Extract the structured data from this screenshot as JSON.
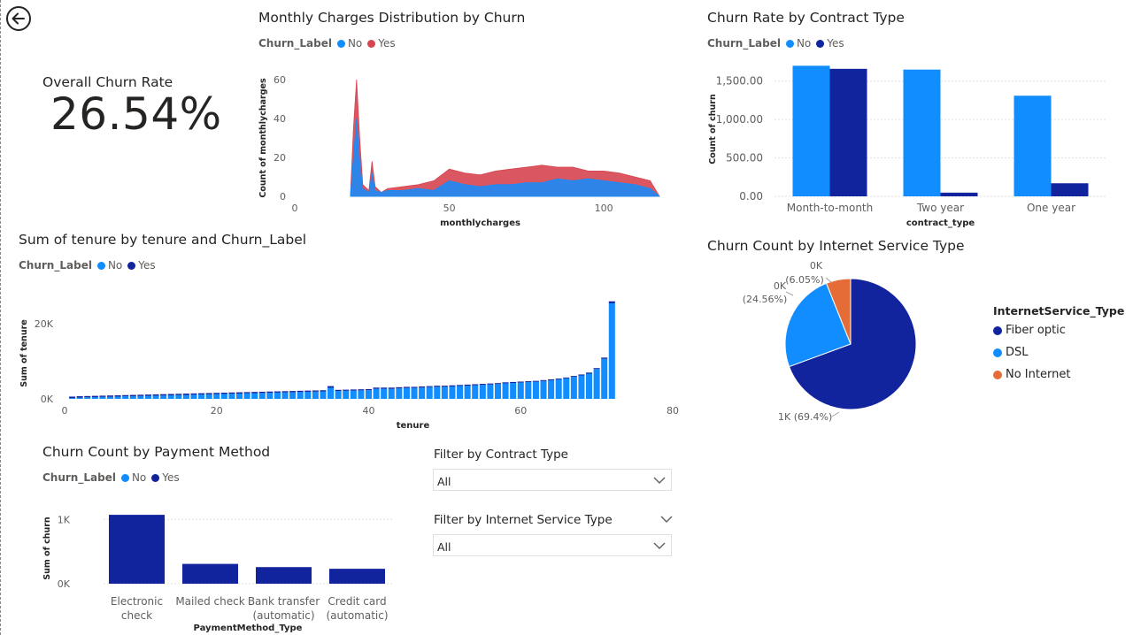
{
  "colors": {
    "no": "#118dff",
    "yes": "#12239e",
    "hist_yes": "#d64550",
    "no_internet": "#e66c37",
    "axis": "#605e5c",
    "grid": "#e1dfdd"
  },
  "kpi": {
    "label": "Overall Churn Rate",
    "value": "26.54%"
  },
  "monthly": {
    "title": "Monthly Charges Distribution by Churn",
    "legend_title": "Churn_Label",
    "legend": [
      "No",
      "Yes"
    ],
    "chart_data": {
      "type": "area",
      "title": "Monthly Charges Distribution by Churn",
      "xlabel": "monthlycharges",
      "ylabel": "Count of monthlycharges",
      "xlim": [
        0,
        120
      ],
      "ylim": [
        0,
        60
      ],
      "xticks": [
        "0",
        "50",
        "100"
      ],
      "yticks": [
        "0",
        "20",
        "40",
        "60"
      ],
      "series": [
        {
          "name": "No",
          "x": [
            18,
            19,
            20,
            21,
            22,
            24,
            25,
            26,
            28,
            30,
            35,
            40,
            45,
            50,
            55,
            60,
            65,
            70,
            75,
            80,
            85,
            90,
            95,
            100,
            105,
            110,
            115,
            118
          ],
          "values": [
            0,
            20,
            40,
            18,
            4,
            2,
            12,
            3,
            2,
            3,
            3,
            4,
            3,
            8,
            6,
            5,
            6,
            6,
            7,
            7,
            9,
            8,
            9,
            8,
            7,
            6,
            4,
            0
          ]
        },
        {
          "name": "Yes",
          "x": [
            18,
            19,
            20,
            21,
            22,
            24,
            25,
            26,
            28,
            30,
            35,
            40,
            45,
            50,
            55,
            60,
            65,
            70,
            75,
            80,
            85,
            90,
            95,
            100,
            105,
            110,
            115,
            118
          ],
          "values": [
            0,
            35,
            60,
            30,
            6,
            3,
            18,
            5,
            2,
            4,
            5,
            6,
            8,
            14,
            12,
            11,
            13,
            14,
            15,
            16,
            15,
            15,
            13,
            13,
            12,
            10,
            8,
            0
          ]
        }
      ]
    }
  },
  "contract": {
    "title": "Churn Rate by Contract Type",
    "legend_title": "Churn_Label",
    "legend": [
      "No",
      "Yes"
    ],
    "chart_data": {
      "type": "bar",
      "title": "Churn Rate by Contract Type",
      "xlabel": "contract_type",
      "ylabel": "Count of churn",
      "categories": [
        "Month-to-month",
        "Two year",
        "One year"
      ],
      "ylim": [
        0,
        1750
      ],
      "yticks": [
        "0.00",
        "500.00",
        "1,000.00",
        "1,500.00"
      ],
      "series": [
        {
          "name": "No",
          "values": [
            1700,
            1650,
            1310
          ]
        },
        {
          "name": "Yes",
          "values": [
            1660,
            48,
            170
          ]
        }
      ]
    }
  },
  "tenure": {
    "title": "Sum of tenure by tenure and Churn_Label",
    "legend_title": "Churn_Label",
    "legend": [
      "No",
      "Yes"
    ],
    "chart_data": {
      "type": "bar",
      "title": "Sum of tenure by tenure and Churn_Label",
      "xlabel": "tenure",
      "ylabel": "Sum of tenure",
      "xlim": [
        0,
        80
      ],
      "ylim": [
        0,
        29000
      ],
      "xticks": [
        "0",
        "20",
        "40",
        "60",
        "80"
      ],
      "yticks": [
        "0K",
        "20K"
      ],
      "x": [
        1,
        2,
        3,
        4,
        5,
        6,
        7,
        8,
        9,
        10,
        11,
        12,
        13,
        14,
        15,
        16,
        17,
        18,
        19,
        20,
        21,
        22,
        23,
        24,
        25,
        26,
        27,
        28,
        29,
        30,
        31,
        32,
        33,
        34,
        35,
        36,
        37,
        38,
        39,
        40,
        41,
        42,
        43,
        44,
        45,
        46,
        47,
        48,
        49,
        50,
        51,
        52,
        53,
        54,
        55,
        56,
        57,
        58,
        59,
        60,
        61,
        62,
        63,
        64,
        65,
        66,
        67,
        68,
        69,
        70,
        71,
        72
      ],
      "total": [
        600,
        700,
        750,
        800,
        850,
        900,
        950,
        1000,
        1050,
        1100,
        1150,
        1200,
        1250,
        1300,
        1350,
        1400,
        1450,
        1500,
        1550,
        1600,
        1650,
        1700,
        1750,
        1800,
        1850,
        1900,
        1950,
        2000,
        2050,
        2100,
        2150,
        2200,
        2250,
        2300,
        3400,
        2400,
        2450,
        2500,
        2550,
        2600,
        3000,
        3000,
        3000,
        3100,
        3200,
        3200,
        3300,
        3400,
        3500,
        3500,
        3600,
        3700,
        3800,
        3900,
        4000,
        4100,
        4200,
        4400,
        4500,
        4600,
        4700,
        4800,
        5000,
        5200,
        5400,
        5700,
        6100,
        6500,
        7000,
        8200,
        11000,
        26000
      ],
      "yes_share": [
        0.6,
        0.5,
        0.45,
        0.42,
        0.4,
        0.38,
        0.36,
        0.34,
        0.32,
        0.31,
        0.3,
        0.29,
        0.28,
        0.27,
        0.26,
        0.25,
        0.24,
        0.23,
        0.22,
        0.21,
        0.2,
        0.2,
        0.19,
        0.18,
        0.18,
        0.17,
        0.17,
        0.16,
        0.16,
        0.15,
        0.15,
        0.14,
        0.14,
        0.13,
        0.13,
        0.12,
        0.12,
        0.12,
        0.11,
        0.11,
        0.11,
        0.1,
        0.1,
        0.1,
        0.09,
        0.09,
        0.09,
        0.08,
        0.08,
        0.08,
        0.08,
        0.07,
        0.07,
        0.07,
        0.07,
        0.06,
        0.06,
        0.06,
        0.06,
        0.05,
        0.05,
        0.05,
        0.05,
        0.05,
        0.04,
        0.04,
        0.04,
        0.04,
        0.04,
        0.03,
        0.03,
        0.02
      ]
    }
  },
  "internet": {
    "title": "Churn Count by Internet Service Type",
    "legend_title": "InternetService_Type",
    "legend": [
      "Fiber optic",
      "DSL",
      "No Internet"
    ],
    "chart_data": {
      "type": "pie",
      "title": "Churn Count by Internet Service Type",
      "categories": [
        "Fiber optic",
        "DSL",
        "No Internet"
      ],
      "values": [
        69.4,
        24.56,
        6.05
      ],
      "labels": [
        "1K (69.4%)",
        "0K (24.56%)",
        "0K (6.05%)"
      ]
    }
  },
  "payment": {
    "title": "Churn Count by Payment Method",
    "legend_title": "Churn_Label",
    "legend": [
      "No",
      "Yes"
    ],
    "chart_data": {
      "type": "bar",
      "title": "Churn Count by Payment Method",
      "xlabel": "PaymentMethod_Type",
      "ylabel": "Sum of churn",
      "categories": [
        [
          "Electronic",
          "check"
        ],
        [
          "Mailed check"
        ],
        [
          "Bank transfer",
          "(automatic)"
        ],
        [
          "Credit card",
          "(automatic)"
        ]
      ],
      "ylim": [
        0,
        1100
      ],
      "yticks": [
        "0K",
        "1K"
      ],
      "series": [
        {
          "name": "Yes",
          "values": [
            1071,
            308,
            258,
            232
          ]
        }
      ]
    }
  },
  "slicers": {
    "contract": {
      "title": "Filter by Contract Type",
      "value": "All"
    },
    "internet": {
      "title": "Filter by Internet Service Type",
      "value": "All"
    }
  }
}
